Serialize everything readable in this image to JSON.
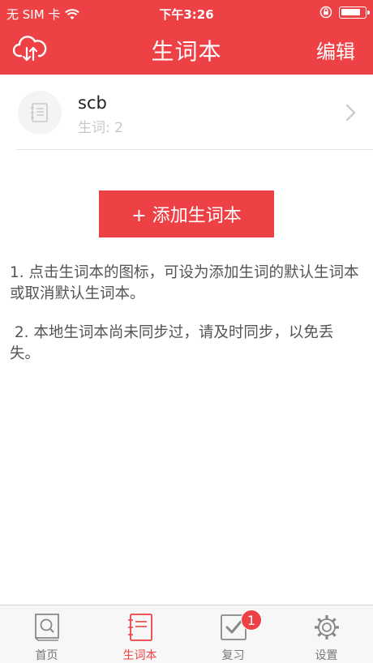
{
  "status_bar": {
    "carrier": "无 SIM 卡",
    "time": "下午3:26",
    "battery_level": 0.85
  },
  "nav": {
    "title": "生词本",
    "right_action": "编辑",
    "left_icon": "cloud-sync-icon"
  },
  "wordbooks": [
    {
      "name": "scb",
      "count_label": "生词: 2",
      "icon": "notebook-icon"
    }
  ],
  "add_button_label": "+ 添加生词本",
  "notes": [
    "1. 点击生词本的图标，可设为添加生词的默认生词本或取消默认生词本。",
    " 2. 本地生词本尚未同步过，请及时同步，以免丢失。"
  ],
  "tabs": [
    {
      "label": "首页",
      "icon": "home-book-search-icon"
    },
    {
      "label": "生词本",
      "icon": "wordbook-icon",
      "active": true
    },
    {
      "label": "复习",
      "icon": "review-check-icon",
      "badge": "1"
    },
    {
      "label": "设置",
      "icon": "settings-gear-icon"
    }
  ],
  "colors": {
    "accent": "#ed4145",
    "tab_inactive": "#777777",
    "muted_text": "#c8c8c8"
  }
}
